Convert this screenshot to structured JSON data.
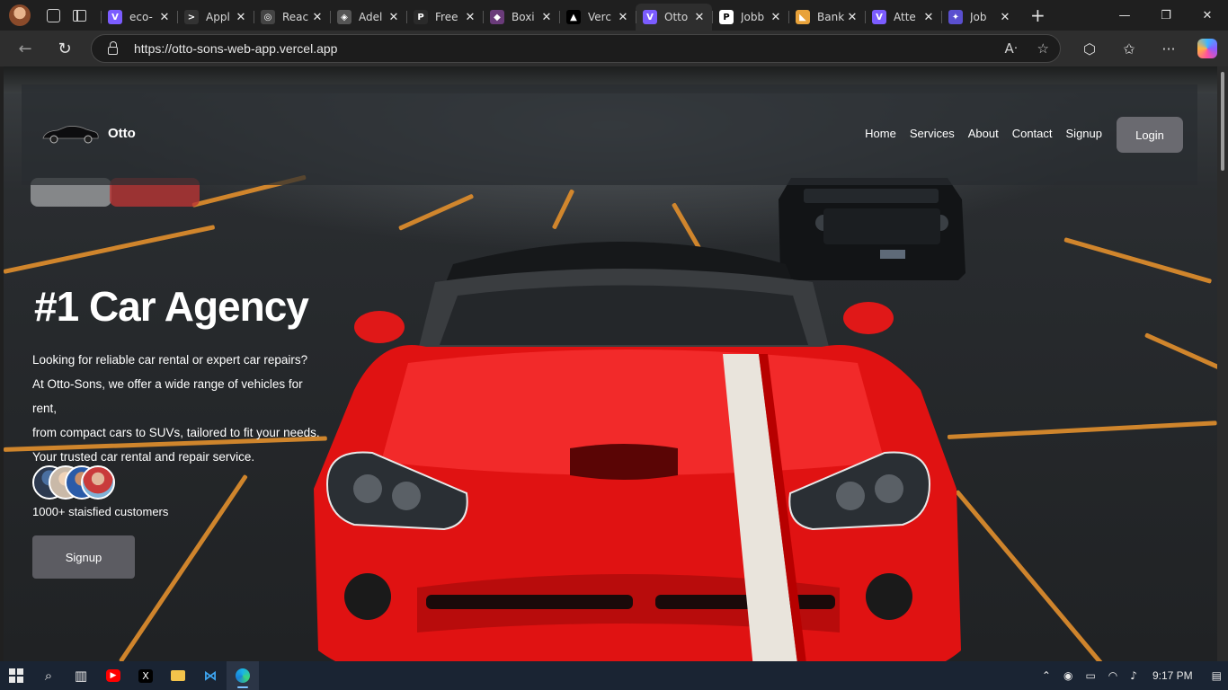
{
  "browser": {
    "tabs": [
      {
        "title": "eco-",
        "fav_color": "#7b5cff",
        "fav_glyph": "V"
      },
      {
        "title": "Appl",
        "fav_color": "#333333",
        "fav_glyph": ">"
      },
      {
        "title": "Reac",
        "fav_color": "#444444",
        "fav_glyph": "◎"
      },
      {
        "title": "Adel",
        "fav_color": "#555555",
        "fav_glyph": "◈"
      },
      {
        "title": "Free",
        "fav_color": "#2a2a2a",
        "fav_glyph": "P"
      },
      {
        "title": "Boxi",
        "fav_color": "#6a3b7a",
        "fav_glyph": "◆"
      },
      {
        "title": "Verc",
        "fav_color": "#000000",
        "fav_glyph": "▲"
      },
      {
        "title": "Otto",
        "fav_color": "#7b5cff",
        "fav_glyph": "V"
      },
      {
        "title": "Jobb",
        "fav_color": "#ffffff",
        "fav_glyph": "P"
      },
      {
        "title": "Bank",
        "fav_color": "#e8a23a",
        "fav_glyph": "◣"
      },
      {
        "title": "Atte",
        "fav_color": "#7b5cff",
        "fav_glyph": "V"
      },
      {
        "title": "Job",
        "fav_color": "#5a4fcf",
        "fav_glyph": "✦"
      }
    ],
    "active_tab_index": 7,
    "url": "https://otto-sons-web-app.vercel.app"
  },
  "site": {
    "brand": "Otto",
    "menu": [
      "Home",
      "Services",
      "About",
      "Contact",
      "Signup"
    ],
    "login_label": "Login",
    "hero_title": "#1 Car Agency",
    "hero_lines": [
      "Looking for reliable car rental or expert car repairs?",
      "At Otto-Sons, we offer a wide range of vehicles for rent,",
      "from compact cars to SUVs, tailored to fit your needs.",
      "Your trusted car rental and repair service."
    ],
    "customers_text": "1000+ staisfied customers",
    "signup_label": "Signup"
  },
  "taskbar": {
    "clock": "9:17 PM"
  }
}
